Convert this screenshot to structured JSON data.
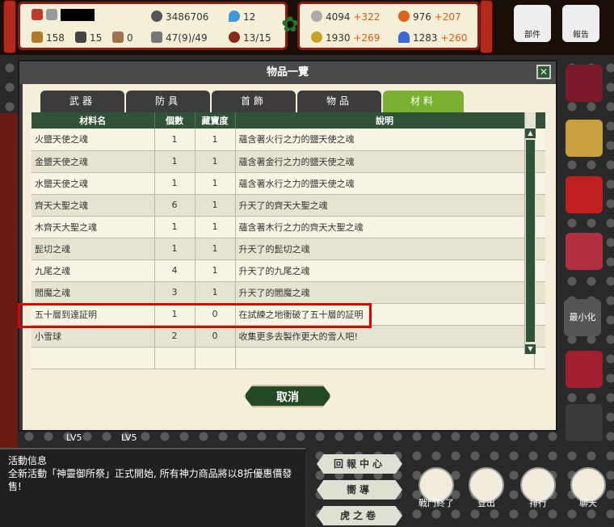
{
  "topbar": {
    "stats_left": [
      {
        "icon": "mail-icon",
        "value": "3486706",
        "name": "coin-stat"
      },
      {
        "icon": "drop-icon",
        "value": "12",
        "name": "water-stat"
      },
      {
        "icon": "chest-icon",
        "value": "158",
        "name": "chest-stat"
      },
      {
        "icon": "swords-icon",
        "value": "15",
        "name": "swords-stat"
      },
      {
        "icon": "scroll-icon",
        "value": "0",
        "name": "scroll-stat"
      },
      {
        "icon": "quill-icon",
        "value": "47(9)/49",
        "name": "quill-stat"
      },
      {
        "icon": "face-icon",
        "value": "13/15",
        "name": "face-stat"
      }
    ],
    "resources": [
      {
        "value": "4094",
        "plus": "+322"
      },
      {
        "value": "976",
        "plus": "+207"
      },
      {
        "value": "1930",
        "plus": "+269"
      },
      {
        "value": "1283",
        "plus": "+260"
      }
    ]
  },
  "side_icons": [
    "部件",
    "報告",
    "最小化"
  ],
  "panel": {
    "title": "物品一覽",
    "close_label": "✕",
    "tabs": [
      "武器",
      "防具",
      "首飾",
      "物品",
      "材料"
    ],
    "active_tab": 4,
    "columns": [
      "材料名",
      "個數",
      "藏寶度",
      "說明"
    ],
    "rows": [
      {
        "name": "火鹽天使之魂",
        "count": "1",
        "treasure": "1",
        "desc": "蘊含著火行之力的鹽天使之魂"
      },
      {
        "name": "金鹽天使之魂",
        "count": "1",
        "treasure": "1",
        "desc": "蘊含著金行之力的鹽天使之魂"
      },
      {
        "name": "水鹽天使之魂",
        "count": "1",
        "treasure": "1",
        "desc": "蘊含著水行之力的鹽天使之魂"
      },
      {
        "name": "齊天大聖之魂",
        "count": "6",
        "treasure": "1",
        "desc": "升天了的齊天大聖之魂"
      },
      {
        "name": "木齊天大聖之魂",
        "count": "1",
        "treasure": "1",
        "desc": "蘊含著木行之力的齊天大聖之魂"
      },
      {
        "name": "髭切之魂",
        "count": "1",
        "treasure": "1",
        "desc": "升天了的髭切之魂"
      },
      {
        "name": "九尾之魂",
        "count": "4",
        "treasure": "1",
        "desc": "升天了的九尾之魂"
      },
      {
        "name": "閻魔之魂",
        "count": "3",
        "treasure": "1",
        "desc": "升天了的閻魔之魂"
      },
      {
        "name": "五十層到達証明",
        "count": "1",
        "treasure": "0",
        "desc": "在試練之地衝破了五十層的証明"
      },
      {
        "name": "小雪球",
        "count": "2",
        "treasure": "0",
        "desc": "收集更多去製作更大的雪人吧!"
      },
      {
        "name": "",
        "count": "",
        "treasure": "",
        "desc": ""
      }
    ],
    "cancel_label": "取消"
  },
  "news": {
    "title": "活動信息",
    "text": "全新活動「神靈御所祭」正式開始, 所有神力商品將以8折優惠價發售!"
  },
  "bottom_buttons": [
    "回報中心",
    "嚮導",
    "虎之卷"
  ],
  "bottom_icons": [
    "戰鬥終了",
    "登出",
    "排行",
    "聊天"
  ],
  "level_labels": [
    "LV5",
    "LV5"
  ],
  "colors": {
    "accent_green": "#7ab030",
    "header_green": "#2f5238",
    "highlight_red": "#e00000"
  }
}
